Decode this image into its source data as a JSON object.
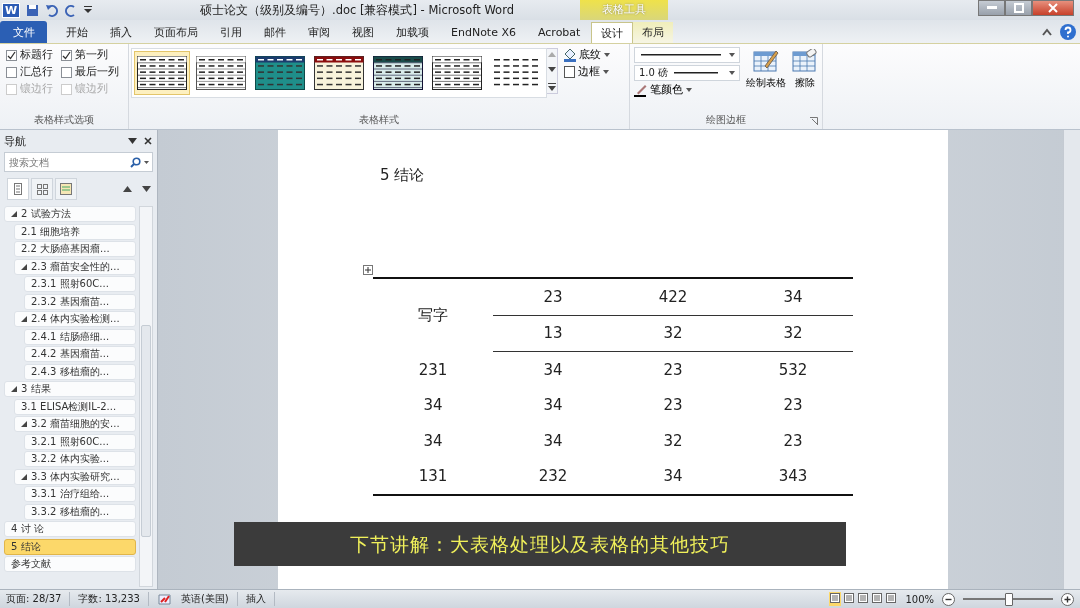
{
  "window": {
    "app_logo": "W",
    "title": "硕士论文（级别及编号）.doc [兼容模式] - Microsoft Word",
    "context_tab_group": "表格工具"
  },
  "tabs": [
    {
      "label": "文件",
      "kind": "file",
      "selected": false
    },
    {
      "label": "开始",
      "kind": "tab",
      "selected": false
    },
    {
      "label": "插入",
      "kind": "tab",
      "selected": false
    },
    {
      "label": "页面布局",
      "kind": "tab",
      "selected": false
    },
    {
      "label": "引用",
      "kind": "tab",
      "selected": false
    },
    {
      "label": "邮件",
      "kind": "tab",
      "selected": false
    },
    {
      "label": "审阅",
      "kind": "tab",
      "selected": false
    },
    {
      "label": "视图",
      "kind": "tab",
      "selected": false
    },
    {
      "label": "加载项",
      "kind": "tab",
      "selected": false
    },
    {
      "label": "EndNote X6",
      "kind": "tab",
      "selected": false
    },
    {
      "label": "Acrobat",
      "kind": "tab",
      "selected": false
    },
    {
      "label": "设计",
      "kind": "context",
      "selected": true
    },
    {
      "label": "布局",
      "kind": "context",
      "selected": false
    }
  ],
  "ribbon": {
    "style_options": {
      "label": "表格样式选项",
      "checkboxes": [
        {
          "label": "标题行",
          "checked": true,
          "disabled": false
        },
        {
          "label": "第一列",
          "checked": true,
          "disabled": false
        },
        {
          "label": "汇总行",
          "checked": false,
          "disabled": false
        },
        {
          "label": "最后一列",
          "checked": false,
          "disabled": false
        },
        {
          "label": "镶边行",
          "checked": false,
          "disabled": true
        },
        {
          "label": "镶边列",
          "checked": false,
          "disabled": true
        }
      ]
    },
    "table_styles": {
      "label": "表格样式",
      "styles": [
        {
          "kind": "grid",
          "selected": true
        },
        {
          "kind": "light-grid",
          "selected": false
        },
        {
          "kind": "teal-banded",
          "selected": false
        },
        {
          "kind": "red-header",
          "selected": false
        },
        {
          "kind": "teal-grid",
          "selected": false
        },
        {
          "kind": "grid",
          "selected": false
        },
        {
          "kind": "lines",
          "selected": false
        }
      ],
      "shading": "底纹",
      "borders": "边框"
    },
    "draw_borders": {
      "label": "绘图边框",
      "weight": "1.0 磅",
      "pen_color": "笔颜色",
      "draw_table": "绘制表格",
      "eraser": "擦除"
    }
  },
  "navigation": {
    "title": "导航",
    "search": {
      "placeholder": "搜索文档"
    },
    "items": [
      {
        "label": "2 试验方法",
        "selected": false,
        "expanded": true,
        "children": [
          {
            "label": "2.1 细胞培养",
            "selected": false
          },
          {
            "label": "2.2 大肠癌基因瘤...",
            "selected": false
          },
          {
            "label": "2.3 瘤苗安全性的...",
            "selected": false,
            "expanded": true,
            "children": [
              {
                "label": "2.3.1 照射60C...",
                "selected": false
              },
              {
                "label": "2.3.2 基因瘤苗...",
                "selected": false
              }
            ]
          },
          {
            "label": "2.4 体内实验检测...",
            "selected": false,
            "expanded": true,
            "children": [
              {
                "label": "2.4.1 结肠癌细...",
                "selected": false
              },
              {
                "label": "2.4.2 基因瘤苗...",
                "selected": false
              },
              {
                "label": "2.4.3 移植瘤的...",
                "selected": false
              }
            ]
          }
        ]
      },
      {
        "label": "3 结果",
        "selected": false,
        "expanded": true,
        "children": [
          {
            "label": "3.1 ELISA检测IL-2...",
            "selected": false
          },
          {
            "label": "3.2 瘤苗细胞的安...",
            "selected": false,
            "expanded": true,
            "children": [
              {
                "label": "3.2.1 照射60C...",
                "selected": false
              },
              {
                "label": "3.2.2 体内实验...",
                "selected": false
              }
            ]
          },
          {
            "label": "3.3 体内实验研究...",
            "selected": false,
            "expanded": true,
            "children": [
              {
                "label": "3.3.1 治疗组给...",
                "selected": false
              },
              {
                "label": "3.3.2 移植瘤的...",
                "selected": false
              }
            ]
          }
        ]
      },
      {
        "label": "4 讨 论",
        "selected": false
      },
      {
        "label": "5 结论",
        "selected": true
      },
      {
        "label": "参考文献",
        "selected": false
      }
    ]
  },
  "document": {
    "heading": "5 结论",
    "table": {
      "header_cell": "写字",
      "header_rows": [
        [
          "23",
          "422",
          "34"
        ],
        [
          "13",
          "32",
          "32"
        ]
      ],
      "rows": [
        [
          "231",
          "34",
          "23",
          "532"
        ],
        [
          "34",
          "34",
          "23",
          "23"
        ],
        [
          "34",
          "34",
          "32",
          "23"
        ],
        [
          "131",
          "232",
          "34",
          "343"
        ]
      ]
    }
  },
  "caption": "下节讲解：大表格处理以及表格的其他技巧",
  "status_bar": {
    "page": "页面: 28/37",
    "words": "字数: 13,233",
    "language": "英语(美国)",
    "mode": "插入",
    "zoom": "100%",
    "zoom_slider": {
      "level": 0.5
    }
  }
}
